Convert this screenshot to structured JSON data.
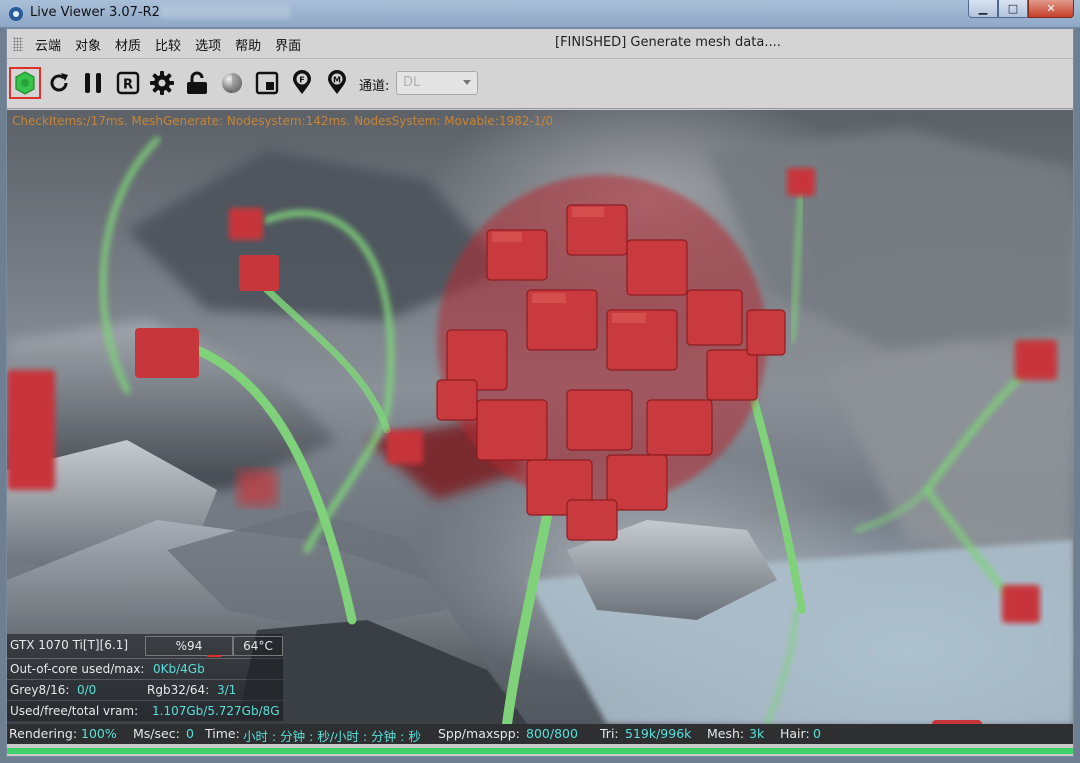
{
  "window": {
    "title": "Live Viewer 3.07-R2"
  },
  "menu": {
    "items": [
      "云端",
      "对象",
      "材质",
      "比较",
      "选项",
      "帮助",
      "界面"
    ],
    "status_message": "[FINISHED] Generate mesh data...."
  },
  "toolbar": {
    "buttons": [
      "send-scene-icon",
      "restart-icon",
      "pause-icon",
      "region-icon",
      "settings-icon",
      "lock-icon",
      "material-ball-icon",
      "window-icon",
      "focus-pick-icon",
      "material-pick-icon"
    ],
    "active_button": "send-scene-icon",
    "channel_label": "通道:",
    "channel_value": "DL"
  },
  "viewport": {
    "debug_line": "CheckItems:/17ms. MeshGenerate: Nodesystem:142ms. NodesSystem: Movable:1982-1/0"
  },
  "overlay": {
    "gpu": {
      "name": "GTX 1070 Ti[T][6.1]",
      "load": "%94",
      "temp": "64°C"
    },
    "out_of_core": {
      "label": "Out-of-core used/max:",
      "value": "0Kb/4Gb"
    },
    "grey": {
      "label": "Grey8/16:",
      "value": "0/0"
    },
    "rgb": {
      "label": "Rgb32/64:",
      "value": "3/1"
    },
    "vram": {
      "label": "Used/free/total vram:",
      "value": "1.107Gb/5.727Gb/8G"
    }
  },
  "statusbar": {
    "rendering_label": "Rendering:",
    "rendering_value": "100%",
    "ms_label": "Ms/sec:",
    "ms_value": "0",
    "time_label": "Time:",
    "time_value": "小时 : 分钟 : 秒/小时 : 分钟 : 秒",
    "spp_label": "Spp/maxspp:",
    "spp_value": "800/800",
    "tri_label": "Tri:",
    "tri_value": "519k/996k",
    "mesh_label": "Mesh:",
    "mesh_value": "3k",
    "hair_label": "Hair:",
    "hair_value": "0"
  },
  "progress": {
    "fraction": 1.0
  },
  "colors": {
    "accent_active": "#e0302a",
    "progress": "#3fd06a",
    "value_text": "#58e0d8"
  }
}
